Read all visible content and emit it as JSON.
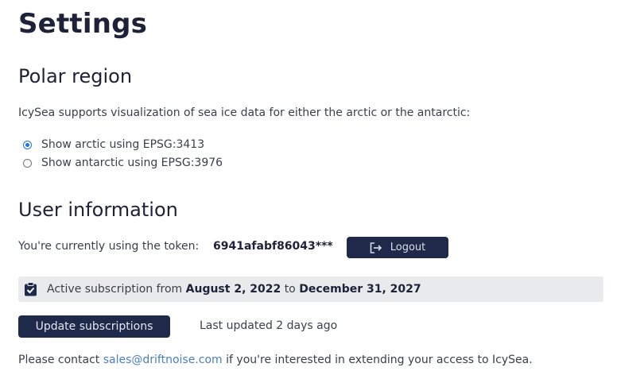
{
  "page": {
    "title": "Settings"
  },
  "polar_region": {
    "title": "Polar region",
    "description": "IcySea supports visualization of sea ice data for either the arctic or the antarctic:",
    "options": [
      {
        "label": "Show arctic using EPSG:3413",
        "selected": true
      },
      {
        "label": "Show antarctic using EPSG:3976",
        "selected": false
      }
    ]
  },
  "user_information": {
    "title": "User information",
    "token_label": "You're currently using the token:",
    "token_value": "6941afabf86043***",
    "logout_label": "Logout",
    "subscription": {
      "prefix": "Active subscription from",
      "start_date": "August 2, 2022",
      "connector": "to",
      "end_date": "December 31, 2027"
    },
    "update_button_label": "Update subscriptions",
    "last_updated": "Last updated 2 days ago",
    "contact": {
      "prefix": "Please contact",
      "email": "sales@driftnoise.com",
      "suffix": "if you're interested in extending your access to IcySea."
    }
  },
  "icons": {
    "logout": "logout-icon",
    "subscription": "clipboard-check-icon"
  },
  "colors": {
    "primary_button": "#1f2a4a",
    "title_text": "#1d2238",
    "link": "#4a7fc1",
    "radio_selected": "#1a73e8",
    "subscription_bar_bg": "#e9eaec"
  }
}
